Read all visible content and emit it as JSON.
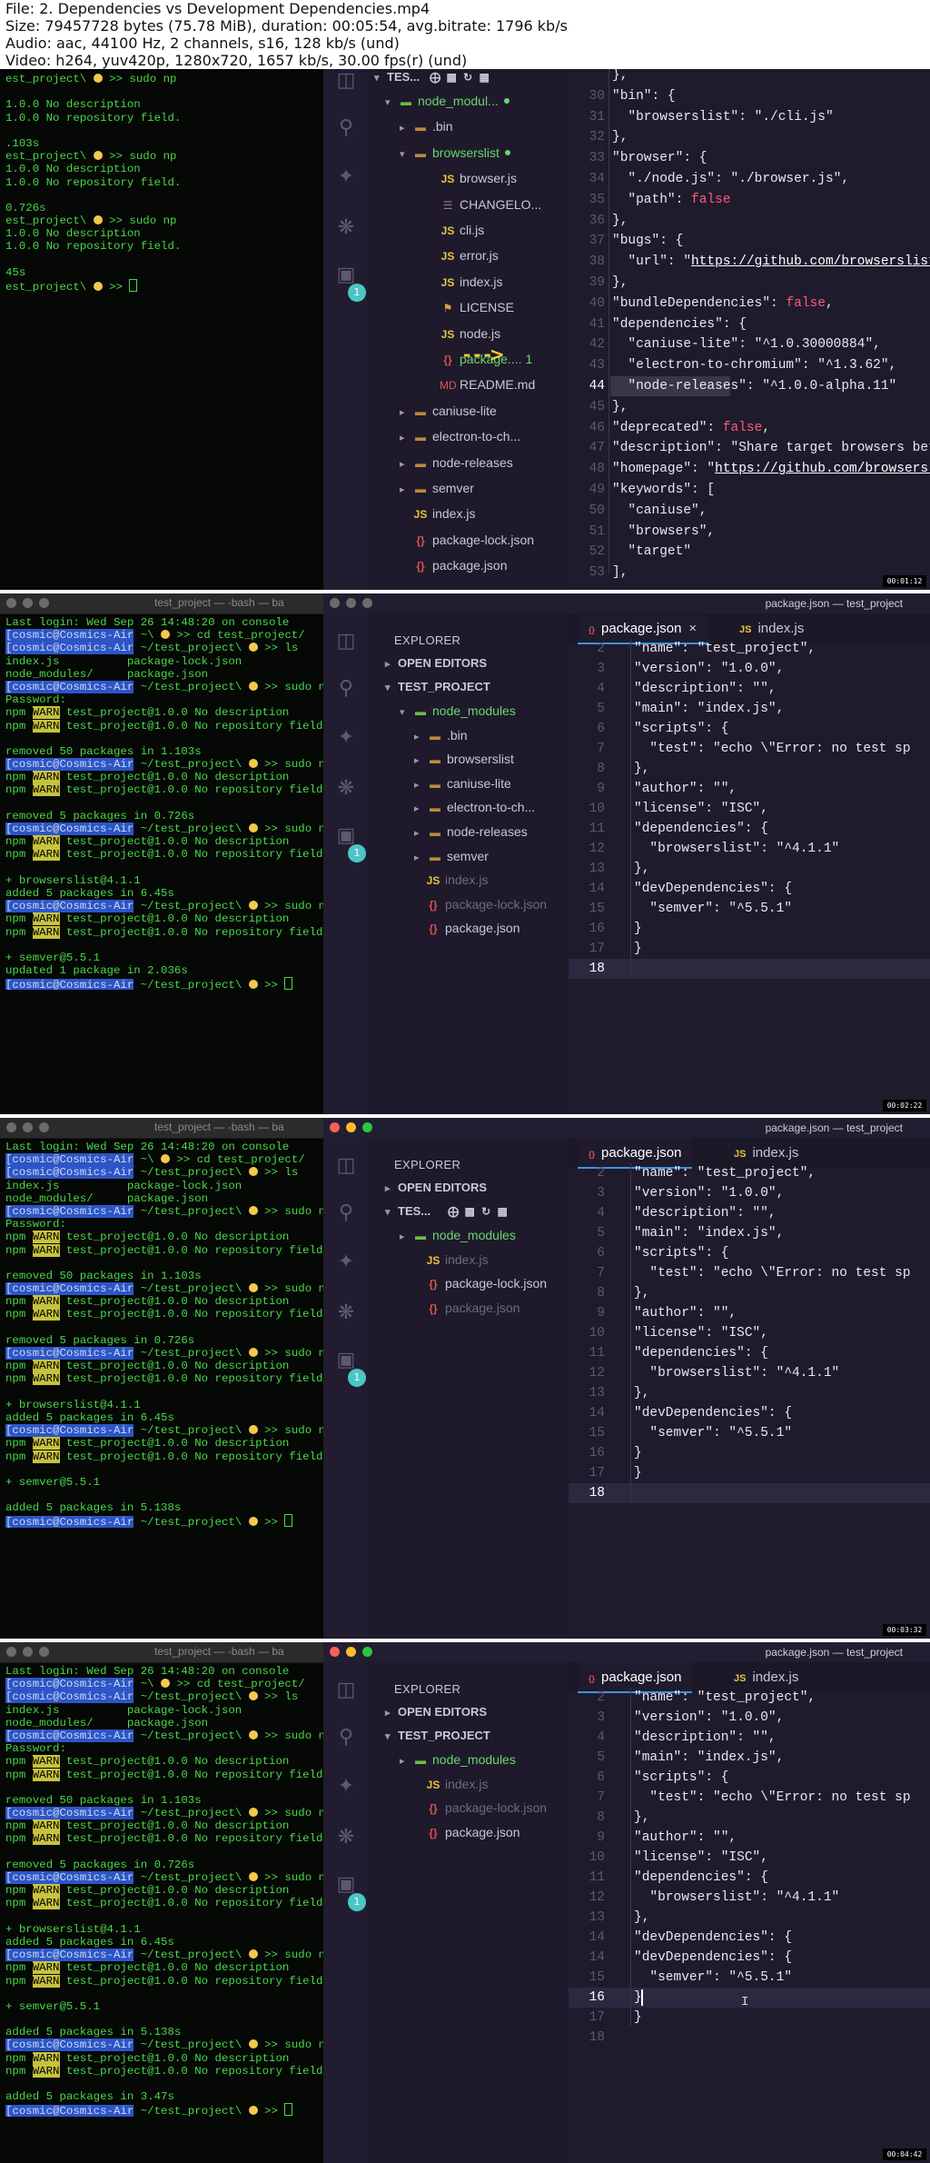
{
  "header": {
    "line1": "File: 2. Dependencies vs Development Dependencies.mp4",
    "line2": "Size: 79457728 bytes (75.78 MiB), duration: 00:05:54, avg.bitrate: 1796 kb/s",
    "line3": "Audio: aac, 44100 Hz, 2 channels, s16, 128 kb/s (und)",
    "line4": "Video: h264, yuv420p, 1280x720, 1657 kb/s, 30.00 fps(r) (und)"
  },
  "frames": [
    {
      "timestamp": "00:01:12",
      "terminal": {
        "title": "",
        "lines": [
          "est_project\\ 😀 >> sudo np",
          "",
          "1.0.0 No description",
          "1.0.0 No repository field.",
          "",
          ".103s",
          "est_project\\ 😀 >> sudo np",
          "1.0.0 No description",
          "1.0.0 No repository field.",
          "",
          "0.726s",
          "est_project\\ 😀 >> sudo np",
          "1.0.0 No description",
          "1.0.0 No repository field.",
          "",
          "45s",
          "est_project\\ 😀 >> []"
        ]
      },
      "explorer": {
        "header": "TES...",
        "rows": [
          {
            "label": "node_modul...",
            "icon": "nm"
          },
          {
            "label": ".bin",
            "icon": "folder"
          },
          {
            "label": "browserslist",
            "icon": "folder"
          },
          {
            "label": "browser.js",
            "icon": "js"
          },
          {
            "label": "CHANGELO...",
            "icon": "chg"
          },
          {
            "label": "cli.js",
            "icon": "js"
          },
          {
            "label": "error.js",
            "icon": "js"
          },
          {
            "label": "index.js",
            "icon": "js"
          },
          {
            "label": "LICENSE",
            "icon": "lic"
          },
          {
            "label": "node.js",
            "icon": "js"
          },
          {
            "label": "package....",
            "icon": "json",
            "count": "1"
          },
          {
            "label": "README.md",
            "icon": "md"
          },
          {
            "label": "caniuse-lite",
            "icon": "folder"
          },
          {
            "label": "electron-to-ch...",
            "icon": "folder"
          },
          {
            "label": "node-releases",
            "icon": "folder"
          },
          {
            "label": "semver",
            "icon": "folder"
          },
          {
            "label": "index.js",
            "icon": "js"
          },
          {
            "label": "package-lock.json",
            "icon": "json"
          },
          {
            "label": "package.json",
            "icon": "json"
          }
        ]
      },
      "code": [
        {
          "n": "",
          "t": "},"
        },
        {
          "n": "30",
          "t": "\"bin\": {"
        },
        {
          "n": "31",
          "t": "  \"browserslist\": \"./cli.js\""
        },
        {
          "n": "32",
          "t": "},"
        },
        {
          "n": "33",
          "t": "\"browser\": {"
        },
        {
          "n": "34",
          "t": "  \"./node.js\": \"./browser.js\","
        },
        {
          "n": "35",
          "t": "  \"path\": false"
        },
        {
          "n": "36",
          "t": "},"
        },
        {
          "n": "37",
          "t": "\"bugs\": {"
        },
        {
          "n": "38",
          "t": "  \"url\": \"https://github.com/browserslist/brow"
        },
        {
          "n": "39",
          "t": "},"
        },
        {
          "n": "40",
          "t": "\"bundleDependencies\": false,"
        },
        {
          "n": "41",
          "t": "\"dependencies\": {"
        },
        {
          "n": "42",
          "t": "  \"caniuse-lite\": \"^1.0.30000884\","
        },
        {
          "n": "43",
          "t": "  \"electron-to-chromium\": \"^1.3.62\","
        },
        {
          "n": "44",
          "t": "  \"node-releases\": \"^1.0.0-alpha.11\""
        },
        {
          "n": "45",
          "t": "},"
        },
        {
          "n": "46",
          "t": "\"deprecated\": false,"
        },
        {
          "n": "47",
          "t": "\"description\": \"Share target browsers between"
        },
        {
          "n": "48",
          "t": "\"homepage\": \"https://github.com/browserslist/b"
        },
        {
          "n": "49",
          "t": "\"keywords\": ["
        },
        {
          "n": "50",
          "t": "  \"caniuse\","
        },
        {
          "n": "51",
          "t": "  \"browsers\","
        },
        {
          "n": "52",
          "t": "  \"target\""
        },
        {
          "n": "53",
          "t": "],"
        }
      ]
    },
    {
      "timestamp": "00:02:22",
      "terminal": {
        "title": "test_project — -bash — ba",
        "lines": [
          "Last login: Wed Sep 26 14:48:20 on console",
          "[cosmic@Cosmics-Air ~\\ 😀 >> cd test_project/",
          "[cosmic@Cosmics-Air ~/test_project\\ 😀 >> ls",
          "index.js          package-lock.json",
          "node_modules/     package.json",
          "[cosmic@Cosmics-Air ~/test_project\\ 😀 >> sudo np",
          "Password:",
          "npm WARN test_project@1.0.0 No description",
          "npm WARN test_project@1.0.0 No repository field.",
          "",
          "removed 50 packages in 1.103s",
          "[cosmic@Cosmics-Air ~/test_project\\ 😀 >> sudo np",
          "npm WARN test_project@1.0.0 No description",
          "npm WARN test_project@1.0.0 No repository field.",
          "",
          "removed 5 packages in 0.726s",
          "[cosmic@Cosmics-Air ~/test_project\\ 😀 >> sudo np",
          "npm WARN test_project@1.0.0 No description",
          "npm WARN test_project@1.0.0 No repository field.",
          "",
          "+ browserslist@4.1.1",
          "added 5 packages in 6.45s",
          "[cosmic@Cosmics-Air ~/test_project\\ 😀 >> sudo np",
          "npm WARN test_project@1.0.0 No description",
          "npm WARN test_project@1.0.0 No repository field.",
          "",
          "+ semver@5.5.1",
          "updated 1 package in 2.036s",
          "[cosmic@Cosmics-Air ~/test_project\\ 😀 >> []"
        ]
      },
      "window_title": "package.json — test_project",
      "explorer": {
        "title": "EXPLORER",
        "open_editors": "OPEN EDITORS",
        "project": "TEST_PROJECT",
        "rows": [
          {
            "label": "node_modules",
            "icon": "nm"
          },
          {
            "label": ".bin",
            "icon": "folder"
          },
          {
            "label": "browserslist",
            "icon": "folder"
          },
          {
            "label": "caniuse-lite",
            "icon": "folder"
          },
          {
            "label": "electron-to-ch...",
            "icon": "folder"
          },
          {
            "label": "node-releases",
            "icon": "folder"
          },
          {
            "label": "semver",
            "icon": "folder"
          },
          {
            "label": "index.js",
            "icon": "js"
          },
          {
            "label": "package-lock.json",
            "icon": "json"
          },
          {
            "label": "package.json",
            "icon": "json"
          }
        ]
      },
      "tabs": [
        "package.json",
        "index.js"
      ],
      "code": [
        {
          "n": "2",
          "t": "\"name\": \"test_project\","
        },
        {
          "n": "3",
          "t": "\"version\": \"1.0.0\","
        },
        {
          "n": "4",
          "t": "\"description\": \"\","
        },
        {
          "n": "5",
          "t": "\"main\": \"index.js\","
        },
        {
          "n": "6",
          "t": "\"scripts\": {"
        },
        {
          "n": "7",
          "t": "  \"test\": \"echo \\\"Error: no test sp"
        },
        {
          "n": "8",
          "t": "},"
        },
        {
          "n": "9",
          "t": "\"author\": \"\","
        },
        {
          "n": "10",
          "t": "\"license\": \"ISC\","
        },
        {
          "n": "11",
          "t": "\"dependencies\": {"
        },
        {
          "n": "12",
          "t": "  \"browserslist\": \"^4.1.1\""
        },
        {
          "n": "13",
          "t": "},"
        },
        {
          "n": "14",
          "t": "\"devDependencies\": {"
        },
        {
          "n": "15",
          "t": "  \"semver\": \"^5.5.1\""
        },
        {
          "n": "16",
          "t": "}"
        },
        {
          "n": "17",
          "t": "}"
        },
        {
          "n": "18",
          "t": ""
        }
      ]
    },
    {
      "timestamp": "00:03:32",
      "terminal": {
        "title": "test_project — -bash — ba",
        "extra": [
          "",
          "added 5 packages in 5.138s",
          "[cosmic@Cosmics-Air ~/test_project\\ 😀 >> []"
        ]
      },
      "window_title": "package.json — test_project",
      "explorer": {
        "title": "EXPLORER",
        "open_editors": "OPEN EDITORS",
        "project": "TES...",
        "rows": [
          {
            "label": "node_modules",
            "icon": "nm"
          },
          {
            "label": "index.js",
            "icon": "js"
          },
          {
            "label": "package-lock.json",
            "icon": "json"
          },
          {
            "label": "package.json",
            "icon": "json"
          }
        ]
      },
      "tabs": [
        "package.json",
        "index.js"
      ]
    },
    {
      "timestamp": "00:04:42",
      "terminal": {
        "title": "test_project — -bash — ba",
        "extra": [
          "",
          "added 5 packages in 5.138s",
          "[cosmic@Cosmics-Air ~/test_project\\ 😀 >> sudo np",
          "npm WARN test_project@1.0.0 No description",
          "npm WARN test_project@1.0.0 No repository field.",
          "",
          "added 5 packages in 3.47s",
          "[cosmic@Cosmics-Air ~/test_project\\ 😀 >> []"
        ]
      },
      "window_title": "package.json — test_project",
      "explorer": {
        "title": "EXPLORER",
        "open_editors": "OPEN EDITORS",
        "project": "TEST_PROJECT",
        "rows": [
          {
            "label": "node_modules",
            "icon": "nm"
          },
          {
            "label": "index.js",
            "icon": "js"
          },
          {
            "label": "package-lock.json",
            "icon": "json"
          },
          {
            "label": "package.json",
            "icon": "json"
          }
        ]
      },
      "tabs": [
        "package.json",
        "index.js"
      ],
      "code_tail": [
        {
          "n": "15",
          "t": "  \"semver\": \"^5.5.1\""
        },
        {
          "n": "16",
          "t": "}"
        },
        {
          "n": "17",
          "t": "}"
        },
        {
          "n": "18",
          "t": ""
        }
      ]
    }
  ]
}
